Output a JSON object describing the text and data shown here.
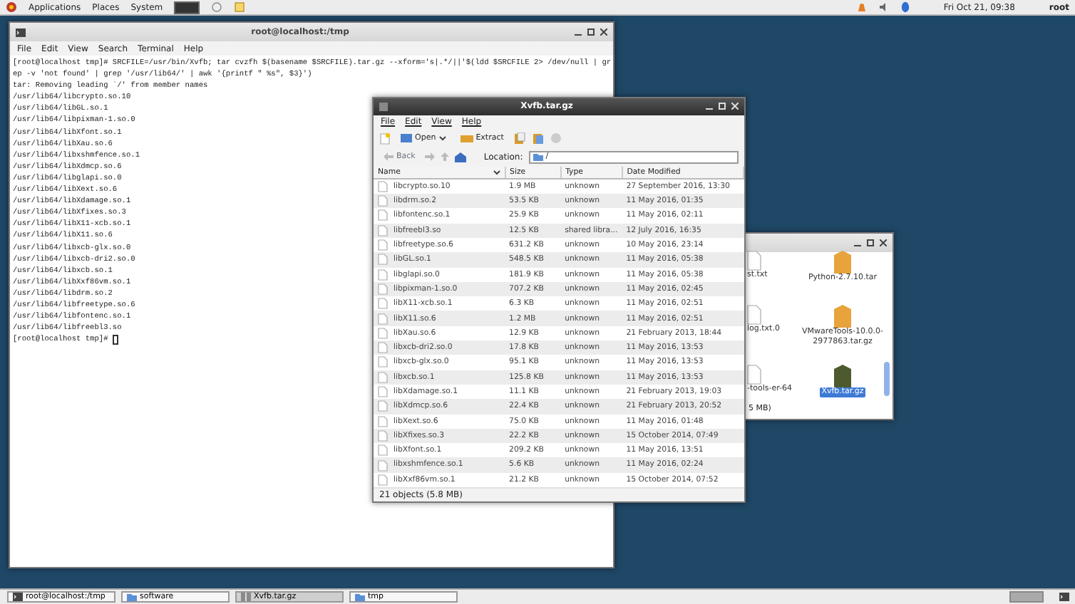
{
  "top_panel": {
    "menus": [
      "Applications",
      "Places",
      "System"
    ],
    "clock": "Fri Oct 21, 09:38",
    "user": "root"
  },
  "terminal": {
    "title": "root@localhost:/tmp",
    "menus": [
      "File",
      "Edit",
      "View",
      "Search",
      "Terminal",
      "Help"
    ],
    "lines": [
      "[root@localhost tmp]# SRCFILE=/usr/bin/Xvfb; tar cvzfh $(basename $SRCFILE).tar.gz --xform='s|.*/||'$(ldd $SRCFILE 2> /dev/null | gr",
      "ep -v 'not found' | grep '/usr/lib64/' | awk '{printf \" %s\", $3}')",
      "tar: Removing leading `/' from member names",
      "/usr/lib64/libcrypto.so.10",
      "/usr/lib64/libGL.so.1",
      "/usr/lib64/libpixman-1.so.0",
      "/usr/lib64/libXfont.so.1",
      "/usr/lib64/libXau.so.6",
      "/usr/lib64/libxshmfence.so.1",
      "/usr/lib64/libXdmcp.so.6",
      "/usr/lib64/libglapi.so.0",
      "/usr/lib64/libXext.so.6",
      "/usr/lib64/libXdamage.so.1",
      "/usr/lib64/libXfixes.so.3",
      "/usr/lib64/libX11-xcb.so.1",
      "/usr/lib64/libX11.so.6",
      "/usr/lib64/libxcb-glx.so.0",
      "/usr/lib64/libxcb-dri2.so.0",
      "/usr/lib64/libxcb.so.1",
      "/usr/lib64/libXxf86vm.so.1",
      "/usr/lib64/libdrm.so.2",
      "/usr/lib64/libfreetype.so.6",
      "/usr/lib64/libfontenc.so.1",
      "/usr/lib64/libfreebl3.so"
    ],
    "prompt": "[root@localhost tmp]# "
  },
  "file_manager": {
    "items": [
      {
        "label": "st.txt",
        "kind": "text",
        "selected": false
      },
      {
        "label": "Python-2.7.10.tar",
        "kind": "archive",
        "selected": false
      },
      {
        "label": "log.txt.0",
        "kind": "text",
        "selected": false
      },
      {
        "label": "VMwareTools-10.0.0-2977863.tar.gz",
        "kind": "archive",
        "selected": false
      },
      {
        "label": "-tools-er-64",
        "kind": "text",
        "selected": false
      },
      {
        "label": "Xvfb.tar.gz",
        "kind": "archive",
        "selected": true
      }
    ],
    "status": "5 MB)"
  },
  "archive_window": {
    "title": "Xvfb.tar.gz",
    "menus": [
      "File",
      "Edit",
      "View",
      "Help"
    ],
    "open": "Open",
    "extract": "Extract",
    "back": "Back",
    "location_label": "Location:",
    "location": "/",
    "columns": [
      "Name",
      "Size",
      "Type",
      "Date Modified"
    ],
    "rows": [
      [
        "libcrypto.so.10",
        "1.9 MB",
        "unknown",
        "27 September 2016, 13:30"
      ],
      [
        "libdrm.so.2",
        "53.5 KB",
        "unknown",
        "11 May 2016, 01:35"
      ],
      [
        "libfontenc.so.1",
        "25.9 KB",
        "unknown",
        "11 May 2016, 02:11"
      ],
      [
        "libfreebl3.so",
        "12.5 KB",
        "shared libra...",
        "12 July 2016, 16:35"
      ],
      [
        "libfreetype.so.6",
        "631.2 KB",
        "unknown",
        "10 May 2016, 23:14"
      ],
      [
        "libGL.so.1",
        "548.5 KB",
        "unknown",
        "11 May 2016, 05:38"
      ],
      [
        "libglapi.so.0",
        "181.9 KB",
        "unknown",
        "11 May 2016, 05:38"
      ],
      [
        "libpixman-1.so.0",
        "707.2 KB",
        "unknown",
        "11 May 2016, 02:45"
      ],
      [
        "libX11-xcb.so.1",
        "6.3 KB",
        "unknown",
        "11 May 2016, 02:51"
      ],
      [
        "libX11.so.6",
        "1.2 MB",
        "unknown",
        "11 May 2016, 02:51"
      ],
      [
        "libXau.so.6",
        "12.9 KB",
        "unknown",
        "21 February 2013, 18:44"
      ],
      [
        "libxcb-dri2.so.0",
        "17.8 KB",
        "unknown",
        "11 May 2016, 13:53"
      ],
      [
        "libxcb-glx.so.0",
        "95.1 KB",
        "unknown",
        "11 May 2016, 13:53"
      ],
      [
        "libxcb.so.1",
        "125.8 KB",
        "unknown",
        "11 May 2016, 13:53"
      ],
      [
        "libXdamage.so.1",
        "11.1 KB",
        "unknown",
        "21 February 2013, 19:03"
      ],
      [
        "libXdmcp.so.6",
        "22.4 KB",
        "unknown",
        "21 February 2013, 20:52"
      ],
      [
        "libXext.so.6",
        "75.0 KB",
        "unknown",
        "11 May 2016, 01:48"
      ],
      [
        "libXfixes.so.3",
        "22.2 KB",
        "unknown",
        "15 October 2014, 07:49"
      ],
      [
        "libXfont.so.1",
        "209.2 KB",
        "unknown",
        "11 May 2016, 13:51"
      ],
      [
        "libxshmfence.so.1",
        "5.6 KB",
        "unknown",
        "11 May 2016, 02:24"
      ],
      [
        "libXxf86vm.so.1",
        "21.2 KB",
        "unknown",
        "15 October 2014, 07:52"
      ]
    ],
    "status": "21 objects (5.8 MB)"
  },
  "taskbar": [
    {
      "label": "root@localhost:/tmp",
      "kind": "terminal",
      "selected": false
    },
    {
      "label": "software",
      "kind": "folder",
      "selected": false
    },
    {
      "label": "Xvfb.tar.gz",
      "kind": "archive",
      "selected": true
    },
    {
      "label": "tmp",
      "kind": "folder",
      "selected": false
    }
  ]
}
